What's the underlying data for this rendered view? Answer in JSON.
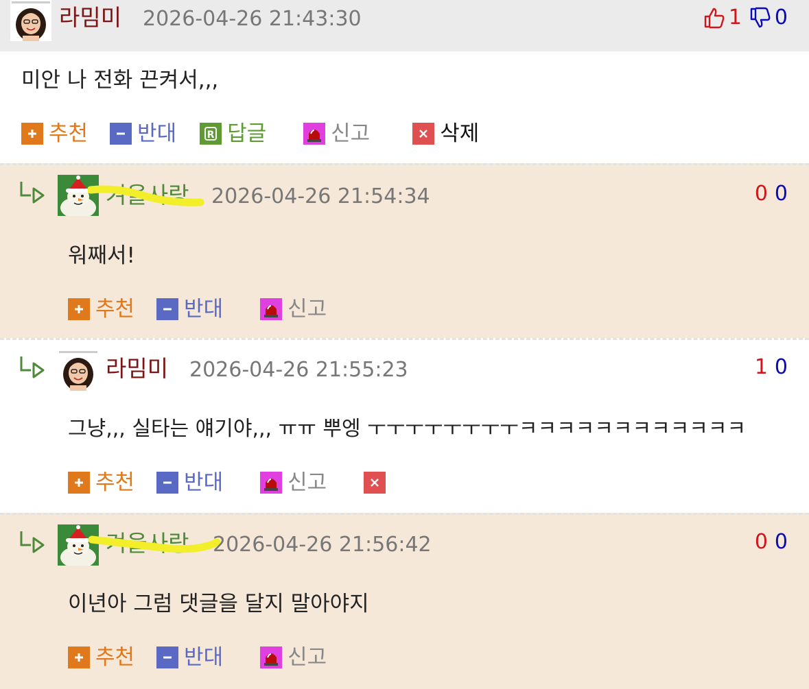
{
  "comments": [
    {
      "nick": "라밈미",
      "date": "2026-04-26 21:43:30",
      "up": "1",
      "down": "0",
      "text": "미안 나 전화 끈켜서,,,",
      "actions": {
        "recommend": "추천",
        "oppose": "반대",
        "reply": "답글",
        "report": "신고",
        "delete": "삭제"
      }
    },
    {
      "nick": "겨울사랑",
      "date": "2026-04-26 21:54:34",
      "up": "0",
      "down": "0",
      "text": "워째서!",
      "actions": {
        "recommend": "추천",
        "oppose": "반대",
        "report": "신고"
      }
    },
    {
      "nick": "라밈미",
      "date": "2026-04-26 21:55:23",
      "up": "1",
      "down": "0",
      "text": "그냥,,, 실타는 얘기야,,, ㅠㅠ 뿌엥 ㅜㅜㅜㅜㅜㅜㅜㅜㅋㅋㅋㅋㅋㅋㅋㅋㅋㅋㅋㅋ",
      "actions": {
        "recommend": "추천",
        "oppose": "반대",
        "report": "신고"
      }
    },
    {
      "nick": "겨울사랑",
      "date": "2026-04-26 21:56:42",
      "up": "0",
      "down": "0",
      "text": "이년아 그럼 댓글을 달지 말아야지",
      "actions": {
        "recommend": "추천",
        "oppose": "반대",
        "report": "신고"
      }
    }
  ],
  "colors": {
    "up": "#d0161a",
    "down": "#0a0ab8",
    "recommend": "#e0781c",
    "oppose": "#5a6ac4",
    "reply": "#5f9a33",
    "report": "#e040e0",
    "delete": "#e05050",
    "reply_bg": "#f6e8d9",
    "head_bg": "#ebebeb"
  },
  "icons": {
    "thumb_up": "thumbs-up-icon",
    "thumb_down": "thumbs-down-icon",
    "recommend": "plus-icon",
    "oppose": "minus-icon",
    "reply": "reply-r-icon",
    "report": "siren-icon",
    "delete": "close-x-icon",
    "reply_arrow": "reply-arrow-icon"
  }
}
